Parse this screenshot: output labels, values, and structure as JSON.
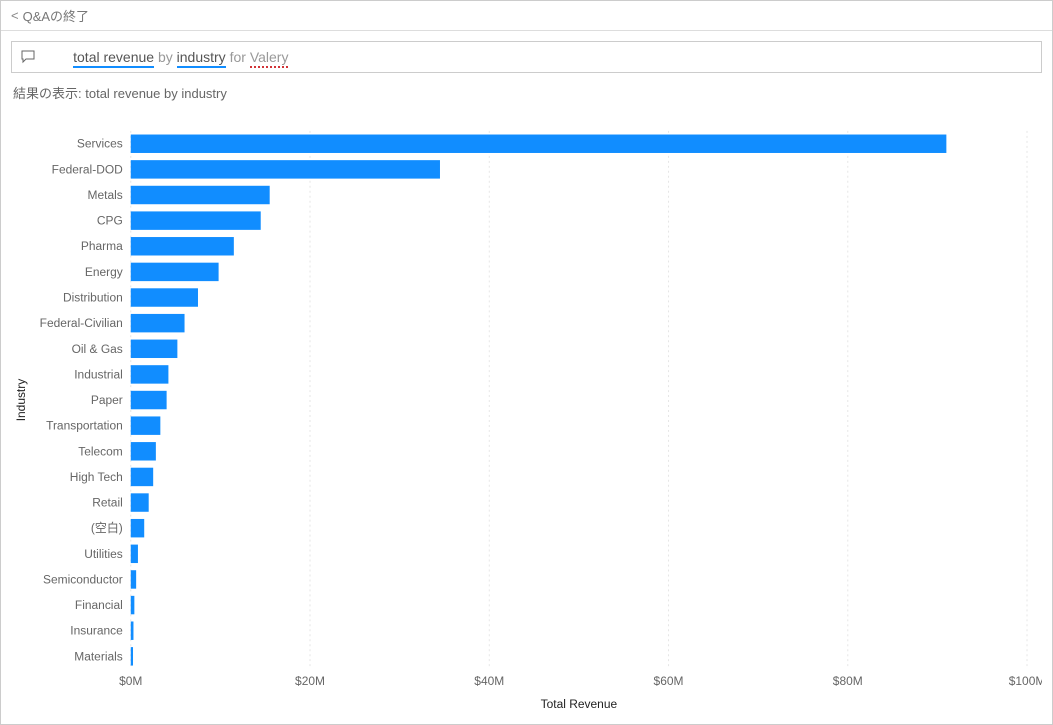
{
  "header": {
    "exit_label": "Q&Aの終了"
  },
  "query": {
    "tokens": [
      {
        "text": "total revenue",
        "kind": "measure"
      },
      {
        "text": "by",
        "kind": "keyword"
      },
      {
        "text": "industry",
        "kind": "dimension"
      },
      {
        "text": "for",
        "kind": "keyword"
      },
      {
        "text": "Valery",
        "kind": "unrecognized"
      }
    ]
  },
  "result": {
    "prefix": "結果の表示: ",
    "showing": "total revenue by industry"
  },
  "chart_data": {
    "type": "bar",
    "orientation": "horizontal",
    "xlabel": "Total Revenue",
    "ylabel": "Industry",
    "xlim": [
      0,
      100
    ],
    "x_unit": "M",
    "x_prefix": "$",
    "x_ticks": [
      0,
      20,
      40,
      60,
      80,
      100
    ],
    "categories": [
      "Services",
      "Federal-DOD",
      "Metals",
      "CPG",
      "Pharma",
      "Energy",
      "Distribution",
      "Federal-Civilian",
      "Oil & Gas",
      "Industrial",
      "Paper",
      "Transportation",
      "Telecom",
      "High Tech",
      "Retail",
      "(空白)",
      "Utilities",
      "Semiconductor",
      "Financial",
      "Insurance",
      "Materials"
    ],
    "values": [
      91.0,
      34.5,
      15.5,
      14.5,
      11.5,
      9.8,
      7.5,
      6.0,
      5.2,
      4.2,
      4.0,
      3.3,
      2.8,
      2.5,
      2.0,
      1.5,
      0.8,
      0.6,
      0.4,
      0.3,
      0.25
    ],
    "bar_color": "#118dff"
  }
}
